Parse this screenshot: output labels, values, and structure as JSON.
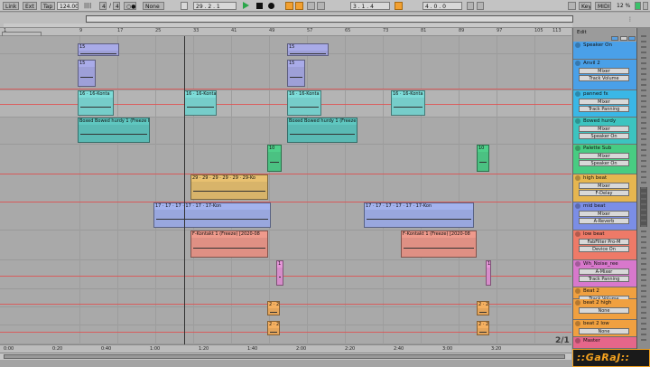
{
  "control_bar": {
    "link": "Link",
    "ext": "Ext",
    "tap": "Tap",
    "tempo": "124.00",
    "bars1": "||||",
    "sig_num": "4",
    "sig_slash": "/",
    "sig_den": "4",
    "metro": "○●",
    "quant": "None",
    "pos": "29 .  2 .  1",
    "loop_start": "3 .  1 .  4",
    "loop_len": "4 .  0 .  0",
    "key": "Key",
    "midi": "MIDI",
    "cpu": "12 %"
  },
  "ruler_ticks": [
    "1",
    "9",
    "17",
    "25",
    "33",
    "41",
    "49",
    "57",
    "65",
    "73",
    "81",
    "89",
    "97",
    "105",
    "113"
  ],
  "time_ticks": [
    "0:00",
    "0:20",
    "0:40",
    "1:00",
    "1:20",
    "1:40",
    "2:00",
    "2:20",
    "2:40",
    "3:00",
    "3:20"
  ],
  "clips": [
    {
      "label": "15",
      "color": "#a9abe8",
      "lane": 0
    },
    {
      "label": "15",
      "color": "#a9abe8",
      "lane": 0
    },
    {
      "label": "15",
      "color": "#a9abe8",
      "lane": 1
    },
    {
      "label": "15",
      "color": "#a9abe8",
      "lane": 1
    },
    {
      "label": "16 · 16-Konta",
      "color": "#7ddcd8",
      "lane": 2
    },
    {
      "label": "16 · 16-Konta",
      "color": "#7ddcd8",
      "lane": 2
    },
    {
      "label": "16 · 16-Konta",
      "color": "#7ddcd8",
      "lane": 2
    },
    {
      "label": "16 · 16-Konta",
      "color": "#7ddcd8",
      "lane": 2
    },
    {
      "label": "Boxed Bowed hurdy 1 (Freeze B",
      "color": "#5fc7c0",
      "lane": 3
    },
    {
      "label": "Boxed Bowed hurdy 1 (Freeze B",
      "color": "#5fc7c0",
      "lane": 3
    },
    {
      "label": "10",
      "color": "#4fcf8a",
      "lane": 4
    },
    {
      "label": "10",
      "color": "#4fcf8a",
      "lane": 4
    },
    {
      "label": "29 · 29 · 29 · 29 · 29 · 29-Ko",
      "color": "#e8c070",
      "lane": 5
    },
    {
      "label": "17 · 17 · 17 · 17 · 17 · 17-Kon",
      "color": "#a3b2ee",
      "lane": 6
    },
    {
      "label": "17 · 17 · 17 · 17 · 17 · 17-Kon",
      "color": "#a3b2ee",
      "lane": 6
    },
    {
      "label": "F-Kontakt 1 (Freeze) [2020-08",
      "color": "#ef9a8c",
      "lane": 7
    },
    {
      "label": "F-Kontakt 1 (Freeze) [2020-08",
      "color": "#ef9a8c",
      "lane": 7
    },
    {
      "label": "1",
      "color": "#e596d8",
      "lane": 8
    },
    {
      "label": "1",
      "color": "#e596d8",
      "lane": 8
    },
    {
      "label": "2 · 2",
      "color": "#f5b060",
      "lane": 9
    },
    {
      "label": "2 · 2",
      "color": "#f5b060",
      "lane": 9
    },
    {
      "label": "2 · 2",
      "color": "#f5b060",
      "lane": 10
    },
    {
      "label": "2 · 2",
      "color": "#f5b060",
      "lane": 10
    }
  ],
  "tracks_panel": {
    "edit_label": "Edit",
    "tracks": [
      {
        "name": "Speaker On",
        "color": "#4aa0e8",
        "fields": []
      },
      {
        "name": "Anvil 2",
        "color": "#4aa0e8",
        "fields": [
          "Mixer",
          "Track Volume"
        ]
      },
      {
        "name": "panned fx",
        "color": "#3ab7e6",
        "fields": [
          "Mixer",
          "Track Panning"
        ]
      },
      {
        "name": "Bowed hurdy",
        "color": "#3cc4c0",
        "fields": [
          "Mixer",
          "Speaker On"
        ]
      },
      {
        "name": "Palette Sub",
        "color": "#48cc82",
        "fields": [
          "Mixer",
          "Speaker On"
        ]
      },
      {
        "name": "high beat",
        "color": "#e6b650",
        "fields": [
          "Mixer",
          "F-Delay"
        ]
      },
      {
        "name": "mid beat",
        "color": "#7b8ee6",
        "fields": [
          "Mixer",
          "A-Reverb"
        ]
      },
      {
        "name": "low beat",
        "color": "#ee7a68",
        "fields": [
          "FabFilter Pro-M",
          "Device On"
        ]
      },
      {
        "name": "Wh_Noise_ree",
        "color": "#d878cc",
        "fields": [
          "A-Mixer",
          "Track Panning"
        ]
      },
      {
        "name": "Beat 2",
        "color": "#f0a040",
        "fields": [
          "Track Volume"
        ]
      },
      {
        "name": "beat 2 high",
        "color": "#f0a040",
        "fields": [
          "None"
        ]
      },
      {
        "name": "beat 2 low",
        "color": "#f0a040",
        "fields": [
          "None"
        ]
      },
      {
        "name": "Master",
        "color": "#e5668a",
        "fields": []
      }
    ]
  },
  "scale_label": "2/1",
  "watermark": "::GaRaJ::"
}
